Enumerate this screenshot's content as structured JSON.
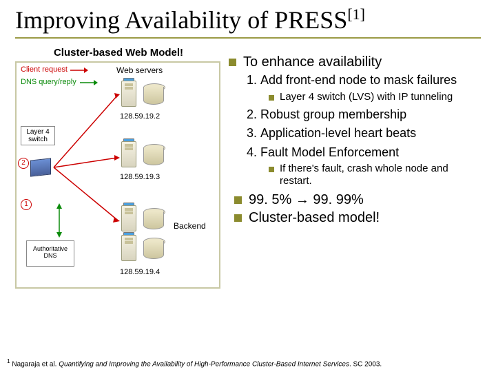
{
  "title_main": "Improving Availability of PRESS",
  "title_sup": "[1]",
  "left": {
    "caption": "Cluster-based Web Model!",
    "client_req": "Client request",
    "dns_qr": "DNS query/reply",
    "layer4": "Layer 4\nswitch",
    "auth_dns": "Authoritative\nDNS",
    "web_servers": "Web servers",
    "backend": "Backend",
    "circle1": "1",
    "circle2": "2",
    "ip1": "128.59.19.2",
    "ip2": "128.59.19.3",
    "ip3": "128.59.19.4"
  },
  "right": {
    "heading": "To enhance availability",
    "items": [
      "Add front-end node to mask failures",
      "Robust group membership",
      "Application-level heart beats",
      "Fault Model Enforcement"
    ],
    "sub1": "Layer 4 switch (LVS) with IP tunneling",
    "sub4": "If there's fault, crash whole node and restart.",
    "result": "99. 5% → 99. 99%",
    "result2": "Cluster-based model!"
  },
  "footnote": {
    "num": "1",
    "pre": " Nagaraja et al. ",
    "ital": "Quantifying and Improving the Availability of High-Performance Cluster-Based Internet Services",
    "post": ". SC 2003."
  }
}
